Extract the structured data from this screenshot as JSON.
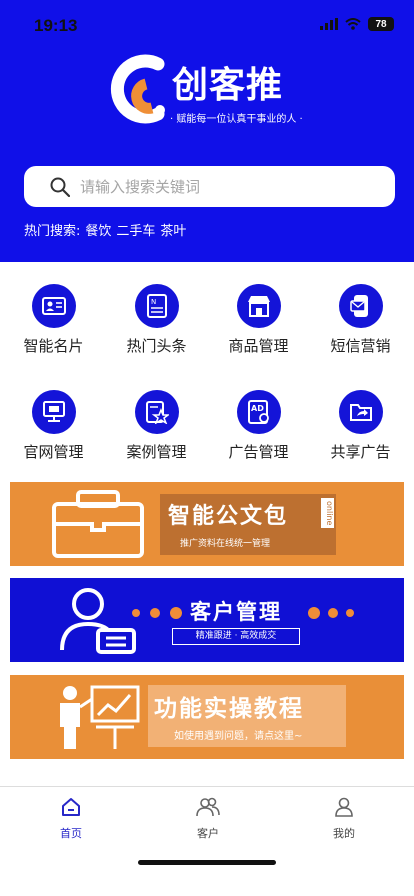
{
  "status_bar": {
    "time": "19:13",
    "battery": "78"
  },
  "header": {
    "brand": "创客推",
    "slogan": "· 赋能每一位认真干事业的人 ·",
    "colors": {
      "primary": "#1010e8",
      "accent": "#e98f38"
    }
  },
  "search": {
    "placeholder": "请输入搜索关键词"
  },
  "hot_search": {
    "label": "热门搜索:",
    "terms": [
      "餐饮",
      "二手车",
      "茶叶"
    ]
  },
  "grid": [
    {
      "label": "智能名片",
      "icon": "business-card-icon"
    },
    {
      "label": "热门头条",
      "icon": "news-icon"
    },
    {
      "label": "商品管理",
      "icon": "shop-icon"
    },
    {
      "label": "短信营销",
      "icon": "sms-icon"
    },
    {
      "label": "官网管理",
      "icon": "monitor-icon"
    },
    {
      "label": "案例管理",
      "icon": "case-star-icon"
    },
    {
      "label": "广告管理",
      "icon": "ad-icon"
    },
    {
      "label": "共享广告",
      "icon": "share-folder-icon"
    }
  ],
  "banners": [
    {
      "title": "智能公文包",
      "tag": "online",
      "subtitle": "推广资料在线统一管理",
      "icon": "briefcase-icon"
    },
    {
      "title": "客户管理",
      "subtitle": "精准跟进 · 高效成交",
      "icon": "customer-icon"
    },
    {
      "title": "功能实操教程",
      "subtitle": "如使用遇到问题，请点这里~",
      "icon": "teacher-icon"
    }
  ],
  "tabbar": [
    {
      "label": "首页",
      "icon": "home-icon",
      "active": true
    },
    {
      "label": "客户",
      "icon": "customers-icon",
      "active": false
    },
    {
      "label": "我的",
      "icon": "profile-icon",
      "active": false
    }
  ]
}
